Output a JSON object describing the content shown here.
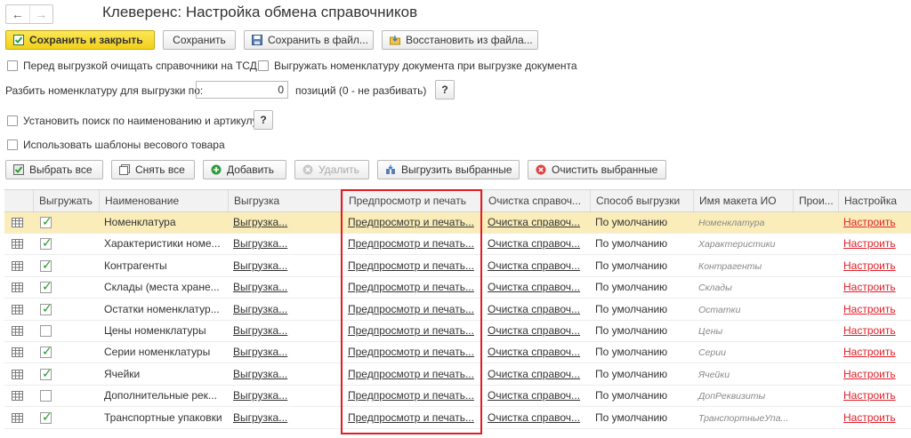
{
  "window": {
    "title": "Клеверенс: Настройка обмена справочников"
  },
  "nav": {
    "back": "←",
    "forward": "→"
  },
  "toolbar": {
    "save_close": "Сохранить и закрыть",
    "save": "Сохранить",
    "save_file": "Сохранить в файл...",
    "restore_file": "Восстановить из файла..."
  },
  "options": {
    "clear_before_export": "Перед выгрузкой очищать справочники на ТСД",
    "export_doc_nomenclature": "Выгружать номенклатуру документа при выгрузке документа",
    "split_label": "Разбить номенклатуру для выгрузки по:",
    "split_value": "0",
    "split_suffix": "позиций (0 - не разбивать)",
    "search_by_name": "Установить поиск по наименованию и артикулу",
    "weight_templates": "Использовать шаблоны весового товара",
    "help": "?"
  },
  "actions": {
    "select_all": "Выбрать все",
    "deselect_all": "Снять все",
    "add": "Добавить",
    "delete": "Удалить",
    "export_selected": "Выгрузить выбранные",
    "clear_selected": "Очистить выбранные"
  },
  "table": {
    "headers": [
      "Выгружать",
      "Наименование",
      "Выгрузка",
      "Предпросмотр и печать",
      "Очистка справоч...",
      "Способ выгрузки",
      "Имя макета ИО",
      "Прои...",
      "Настройка"
    ],
    "rows": [
      {
        "checked": true,
        "name": "Номенклатура",
        "export": "Выгрузка...",
        "preview": "Предпросмотр и печать...",
        "clear": "Очистка справоч...",
        "method": "По умолчанию",
        "layout": "Номенклатура",
        "settings": "Настроить"
      },
      {
        "checked": true,
        "name": "Характеристики номе...",
        "export": "Выгрузка...",
        "preview": "Предпросмотр и печать...",
        "clear": "Очистка справоч...",
        "method": "По умолчанию",
        "layout": "Характеристики",
        "settings": "Настроить"
      },
      {
        "checked": true,
        "name": "Контрагенты",
        "export": "Выгрузка...",
        "preview": "Предпросмотр и печать...",
        "clear": "Очистка справоч...",
        "method": "По умолчанию",
        "layout": "Контрагенты",
        "settings": "Настроить"
      },
      {
        "checked": true,
        "name": "Склады (места хране...",
        "export": "Выгрузка...",
        "preview": "Предпросмотр и печать...",
        "clear": "Очистка справоч...",
        "method": "По умолчанию",
        "layout": "Склады",
        "settings": "Настроить"
      },
      {
        "checked": true,
        "name": "Остатки номенклатур...",
        "export": "Выгрузка...",
        "preview": "Предпросмотр и печать...",
        "clear": "Очистка справоч...",
        "method": "По умолчанию",
        "layout": "Остатки",
        "settings": "Настроить"
      },
      {
        "checked": false,
        "name": "Цены номенклатуры",
        "export": "Выгрузка...",
        "preview": "Предпросмотр и печать...",
        "clear": "Очистка справоч...",
        "method": "По умолчанию",
        "layout": "Цены",
        "settings": "Настроить"
      },
      {
        "checked": true,
        "name": "Серии номенклатуры",
        "export": "Выгрузка...",
        "preview": "Предпросмотр и печать...",
        "clear": "Очистка справоч...",
        "method": "По умолчанию",
        "layout": "Серии",
        "settings": "Настроить"
      },
      {
        "checked": true,
        "name": "Ячейки",
        "export": "Выгрузка...",
        "preview": "Предпросмотр и печать...",
        "clear": "Очистка справоч...",
        "method": "По умолчанию",
        "layout": "Ячейки",
        "settings": "Настроить"
      },
      {
        "checked": false,
        "name": "Дополнительные рек...",
        "export": "Выгрузка...",
        "preview": "Предпросмотр и печать...",
        "clear": "Очистка справоч...",
        "method": "По умолчанию",
        "layout": "ДопРеквизиты",
        "settings": "Настроить"
      },
      {
        "checked": true,
        "name": "Транспортные упаковки",
        "export": "Выгрузка...",
        "preview": "Предпросмотр и печать...",
        "clear": "Очистка справоч...",
        "method": "По умолчанию",
        "layout": "ТранспортныеУпа...",
        "settings": "Настроить"
      }
    ]
  },
  "colors": {
    "accent_yellow": "#f2cf1a",
    "link_red": "#e0202a",
    "highlight_red": "#e01c24",
    "check_green": "#1d9b2a",
    "selected_row": "#fbedb9"
  }
}
